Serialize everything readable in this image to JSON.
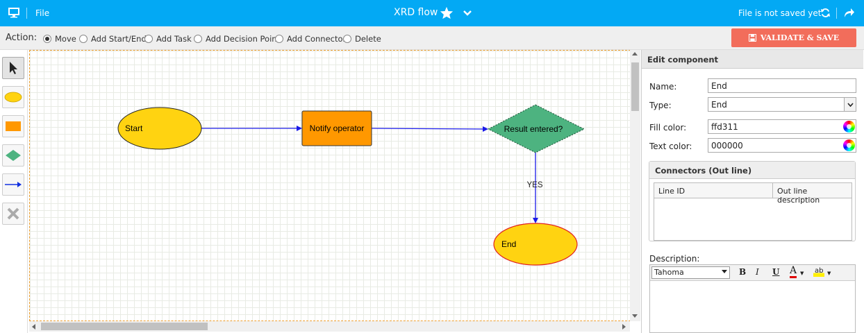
{
  "topbar": {
    "file_label": "File",
    "title": "XRD flow",
    "status": "File is not saved yet",
    "bg_color": "#03a9f4"
  },
  "actionbar": {
    "label": "Action:",
    "options": [
      {
        "label": "Move",
        "selected": true
      },
      {
        "label": "Add Start/End",
        "selected": false
      },
      {
        "label": "Add Task",
        "selected": false
      },
      {
        "label": "Add Decision Point",
        "selected": false
      },
      {
        "label": "Add Connector",
        "selected": false
      },
      {
        "label": "Delete",
        "selected": false
      }
    ],
    "validate_label": "VALIDATE & SAVE",
    "validate_color": "#f26d5b"
  },
  "toolbox": {
    "tools": [
      "pointer-icon",
      "ellipse-icon",
      "rectangle-icon",
      "diamond-icon",
      "arrow-icon",
      "delete-icon"
    ]
  },
  "flow": {
    "nodes": {
      "start": {
        "label": "Start",
        "fill": "#ffd311"
      },
      "task": {
        "label": "Notify operator",
        "fill": "#ff9800"
      },
      "decision": {
        "label": "Result entered?",
        "fill": "#4db380"
      },
      "end": {
        "label": "End",
        "fill": "#ffd311"
      }
    },
    "edge_label": "YES"
  },
  "panel": {
    "header": "Edit component",
    "name_label": "Name:",
    "name_value": "End",
    "type_label": "Type:",
    "type_value": "End",
    "fill_label": "Fill color:",
    "fill_value": "ffd311",
    "text_label": "Text color:",
    "text_value": "000000",
    "connectors": {
      "title": "Connectors (Out line)",
      "col1": "Line ID",
      "col2": "Out line description"
    },
    "description_label": "Description:",
    "editor": {
      "font": "Tahoma",
      "bold": "B",
      "italic": "I",
      "underline": "U",
      "font_color_glyph": "A",
      "highlight_glyph": "ab"
    }
  }
}
